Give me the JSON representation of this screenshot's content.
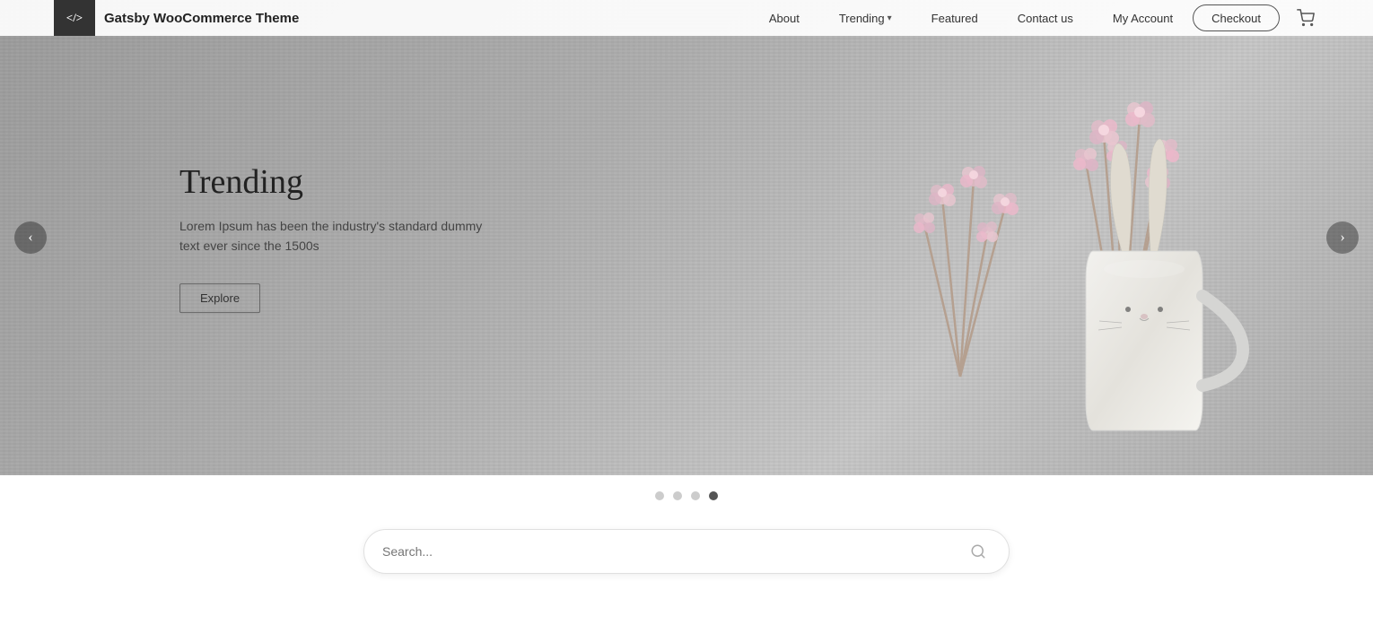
{
  "header": {
    "logo_icon_text": "</>",
    "logo_title": "Gatsby WooCommerce Theme",
    "nav": {
      "items": [
        {
          "id": "about",
          "label": "About",
          "has_dropdown": false
        },
        {
          "id": "trending",
          "label": "Trending",
          "has_dropdown": true
        },
        {
          "id": "featured",
          "label": "Featured",
          "has_dropdown": false
        },
        {
          "id": "contact",
          "label": "Contact us",
          "has_dropdown": false
        },
        {
          "id": "account",
          "label": "My Account",
          "has_dropdown": false
        }
      ],
      "checkout_label": "Checkout"
    }
  },
  "hero": {
    "slide_title": "Trending",
    "slide_description": "Lorem Ipsum has been the industry's standard dummy text ever since the 1500s",
    "explore_label": "Explore",
    "prev_arrow": "‹",
    "next_arrow": "›",
    "dots": [
      {
        "id": 1,
        "active": false
      },
      {
        "id": 2,
        "active": false
      },
      {
        "id": 3,
        "active": false
      },
      {
        "id": 4,
        "active": true
      }
    ]
  },
  "search": {
    "placeholder": "Search..."
  },
  "icons": {
    "cart": "🛒",
    "search": "🔍",
    "code": "</>"
  }
}
